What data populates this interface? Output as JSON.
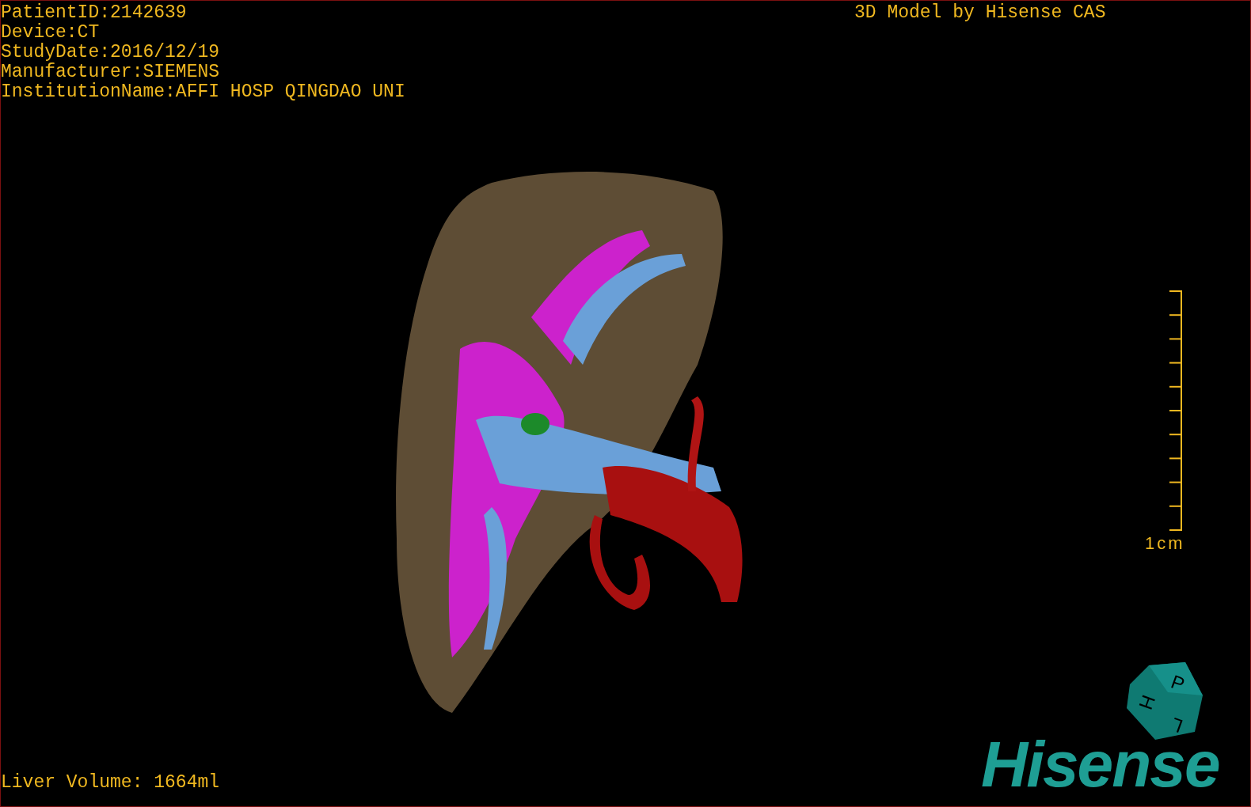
{
  "info_lines": [
    "PatientID:2142639",
    "Device:CT",
    "StudyDate:2016/12/19",
    "Manufacturer:SIEMENS",
    "InstitutionName:AFFI HOSP QINGDAO UNI"
  ],
  "title": "3D Model by Hisense CAS",
  "scale": {
    "label": "1cm"
  },
  "orientation_cube": {
    "faces": [
      "P",
      "H",
      "L"
    ]
  },
  "volume": "Liver Volume: 1664ml",
  "logo": "Hisense"
}
